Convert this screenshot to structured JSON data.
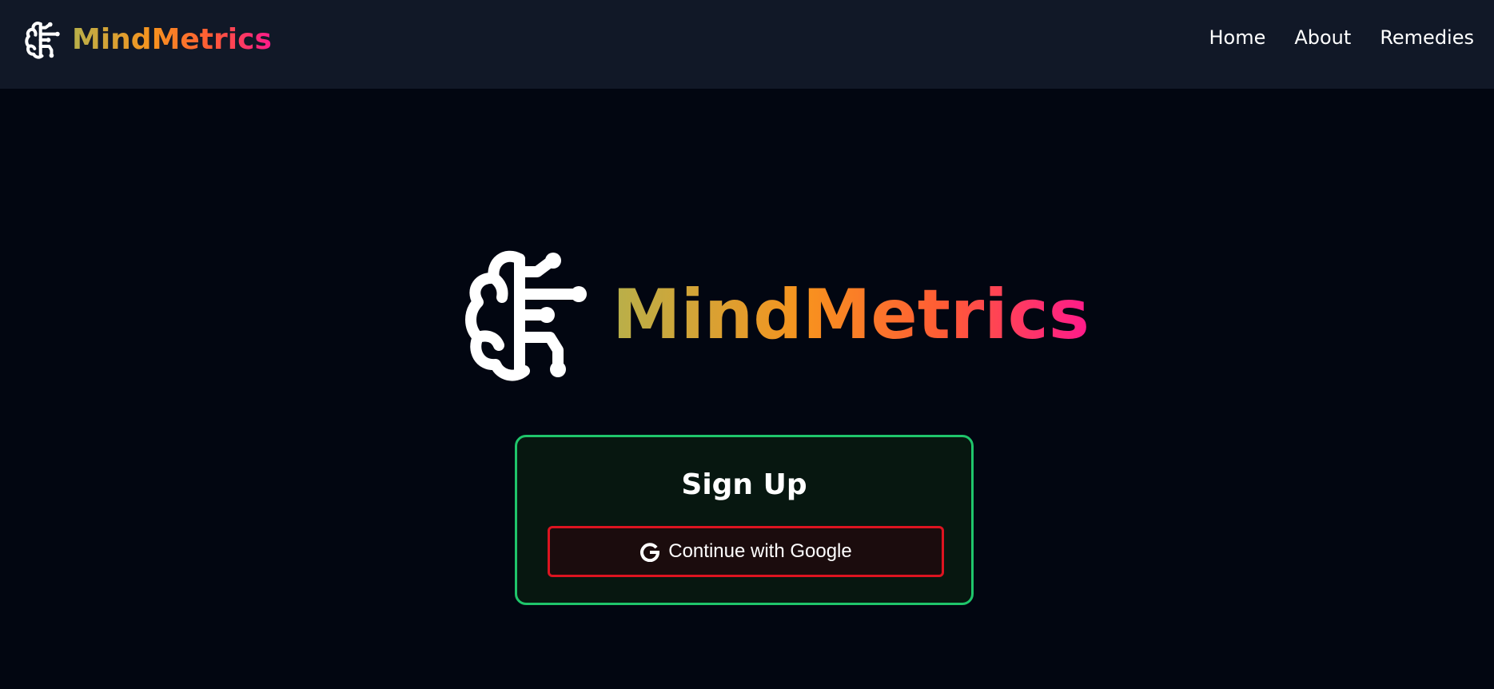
{
  "navbar": {
    "brand": "MindMetrics",
    "links": [
      {
        "label": "Home"
      },
      {
        "label": "About"
      },
      {
        "label": "Remedies"
      }
    ]
  },
  "hero": {
    "brand": "MindMetrics"
  },
  "signup": {
    "title": "Sign Up",
    "google_button_label": "Continue with Google",
    "google_icon": "google-g-icon"
  },
  "colors": {
    "background": "#020611",
    "navbar": "#111827",
    "card_border": "#1fc56b",
    "card_background": "#071710",
    "button_border": "#dc1420",
    "button_background": "#1b0c0d",
    "brand_gradient": [
      "#b8b04a",
      "#f7931e",
      "#ff5a36",
      "#ff1a8c"
    ]
  }
}
